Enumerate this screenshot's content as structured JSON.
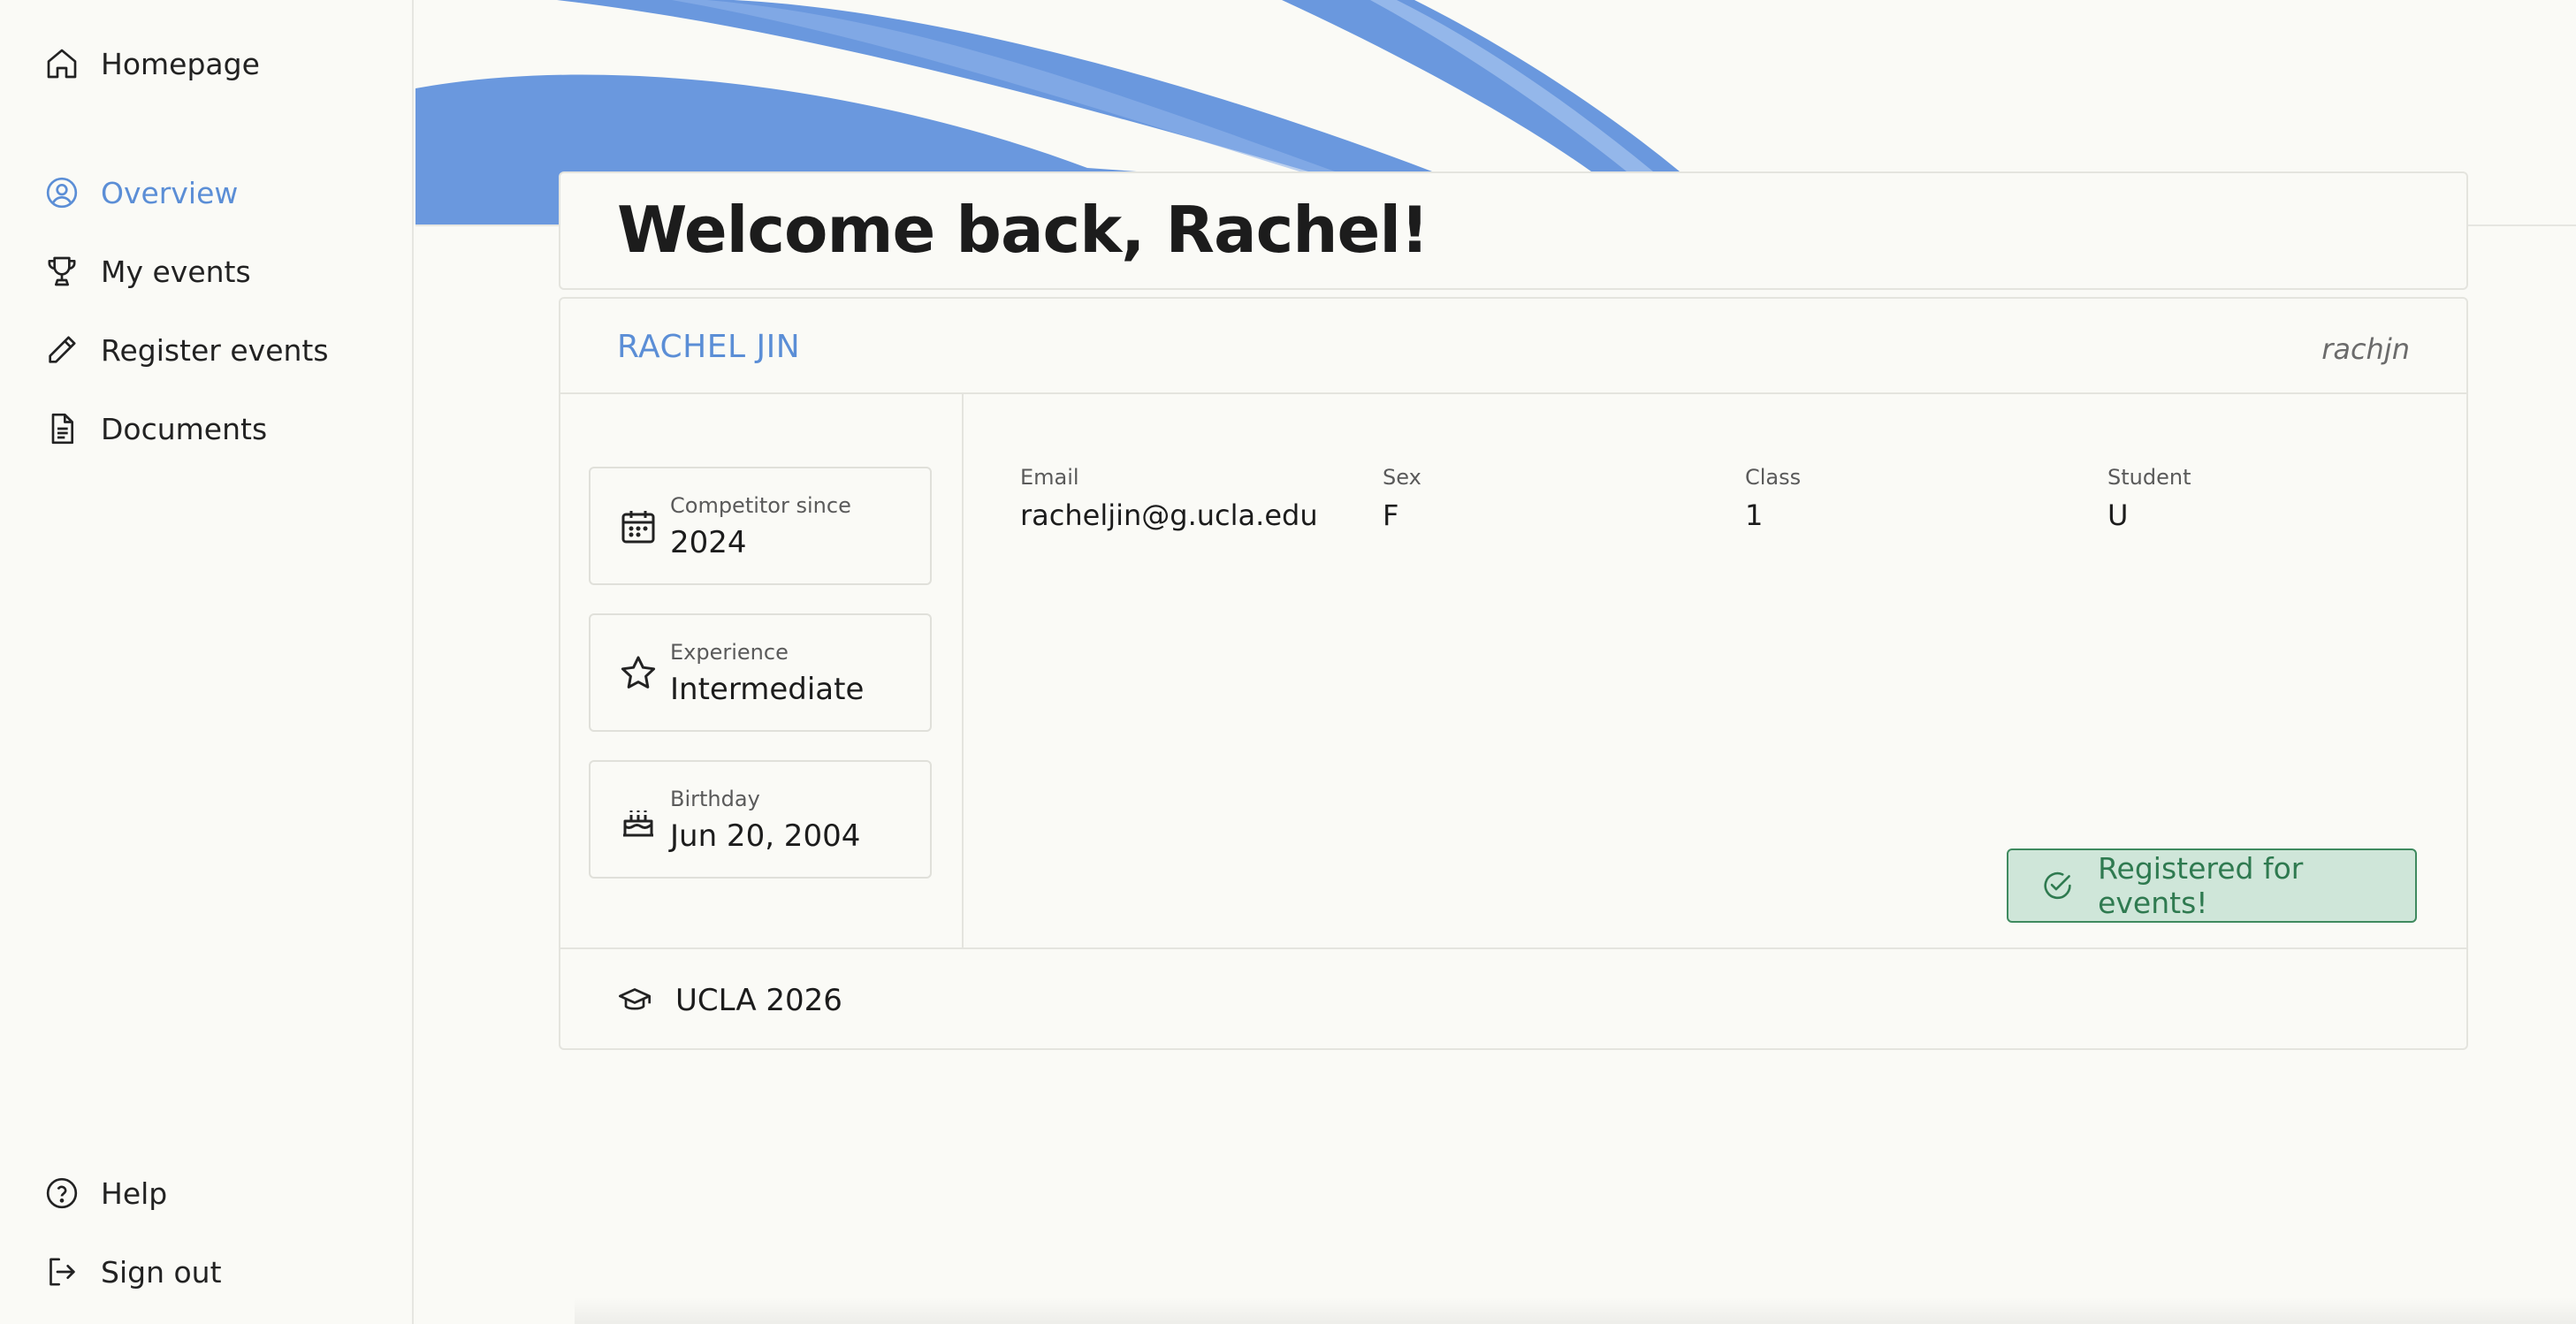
{
  "sidebar": {
    "homepage": {
      "label": "Homepage",
      "icon": "home-icon"
    },
    "items": [
      {
        "label": "Overview",
        "icon": "user-circle-icon",
        "active": true
      },
      {
        "label": "My events",
        "icon": "trophy-icon",
        "active": false
      },
      {
        "label": "Register events",
        "icon": "pencil-icon",
        "active": false
      },
      {
        "label": "Documents",
        "icon": "document-icon",
        "active": false
      }
    ],
    "bottom": [
      {
        "label": "Help",
        "icon": "help-icon"
      },
      {
        "label": "Sign out",
        "icon": "sign-out-icon"
      }
    ]
  },
  "welcome": {
    "title": "Welcome back, Rachel!"
  },
  "profile": {
    "name": "RACHEL JIN",
    "username": "rachjn",
    "stats": [
      {
        "label": "Competitor since",
        "value": "2024",
        "icon": "calendar-icon"
      },
      {
        "label": "Experience",
        "value": "Intermediate",
        "icon": "star-icon"
      },
      {
        "label": "Birthday",
        "value": "Jun 20, 2004",
        "icon": "cake-icon"
      }
    ],
    "info": [
      {
        "label": "Email",
        "value": "racheljin@g.ucla.edu"
      },
      {
        "label": "Sex",
        "value": "F"
      },
      {
        "label": "Class",
        "value": "1"
      },
      {
        "label": "Student",
        "value": "U"
      }
    ],
    "registered_badge": "Registered for events!",
    "school": "UCLA 2026"
  },
  "colors": {
    "accent": "#5b8ed6",
    "success_bg": "#cfe6d9",
    "success_text": "#2f7a50",
    "background": "#fafaf6"
  }
}
